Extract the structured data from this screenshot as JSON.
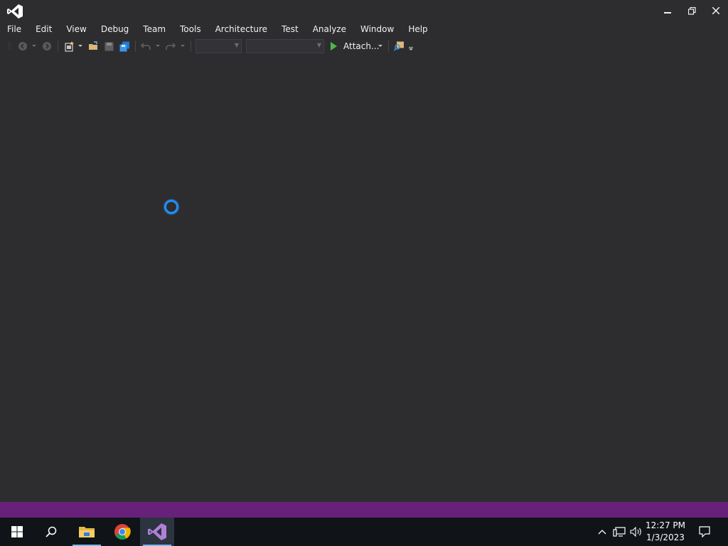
{
  "window": {
    "app_icon": "visual-studio-logo",
    "controls": {
      "minimize_icon": "minimize-icon",
      "restore_icon": "restore-icon",
      "close_icon": "close-icon"
    }
  },
  "menu": {
    "items": [
      "File",
      "Edit",
      "View",
      "Debug",
      "Team",
      "Tools",
      "Architecture",
      "Test",
      "Analyze",
      "Window",
      "Help"
    ]
  },
  "toolbar": {
    "attach_label": "Attach...",
    "icons": [
      "navigate-back-icon",
      "navigate-forward-icon",
      "new-project-icon",
      "open-file-icon",
      "save-icon",
      "save-all-icon",
      "undo-icon",
      "redo-icon",
      "start-icon",
      "find-in-files-icon"
    ],
    "config_combo_value": "",
    "platform_combo_value": ""
  },
  "main": {
    "loading_indicator": "spinner"
  },
  "colors": {
    "background": "#2d2d30",
    "statusbar": "#68217a",
    "taskbar": "#101418",
    "accent": "#1e90ff"
  },
  "taskbar": {
    "apps": [
      "windows-start-icon",
      "search-icon",
      "file-explorer-icon",
      "chrome-icon",
      "visual-studio-icon"
    ],
    "active_app": "visual-studio-icon",
    "tray": [
      "chevron-up-icon",
      "network-icon",
      "volume-icon",
      "notifications-icon"
    ],
    "time": "12:27 PM",
    "date": "1/3/2023"
  }
}
